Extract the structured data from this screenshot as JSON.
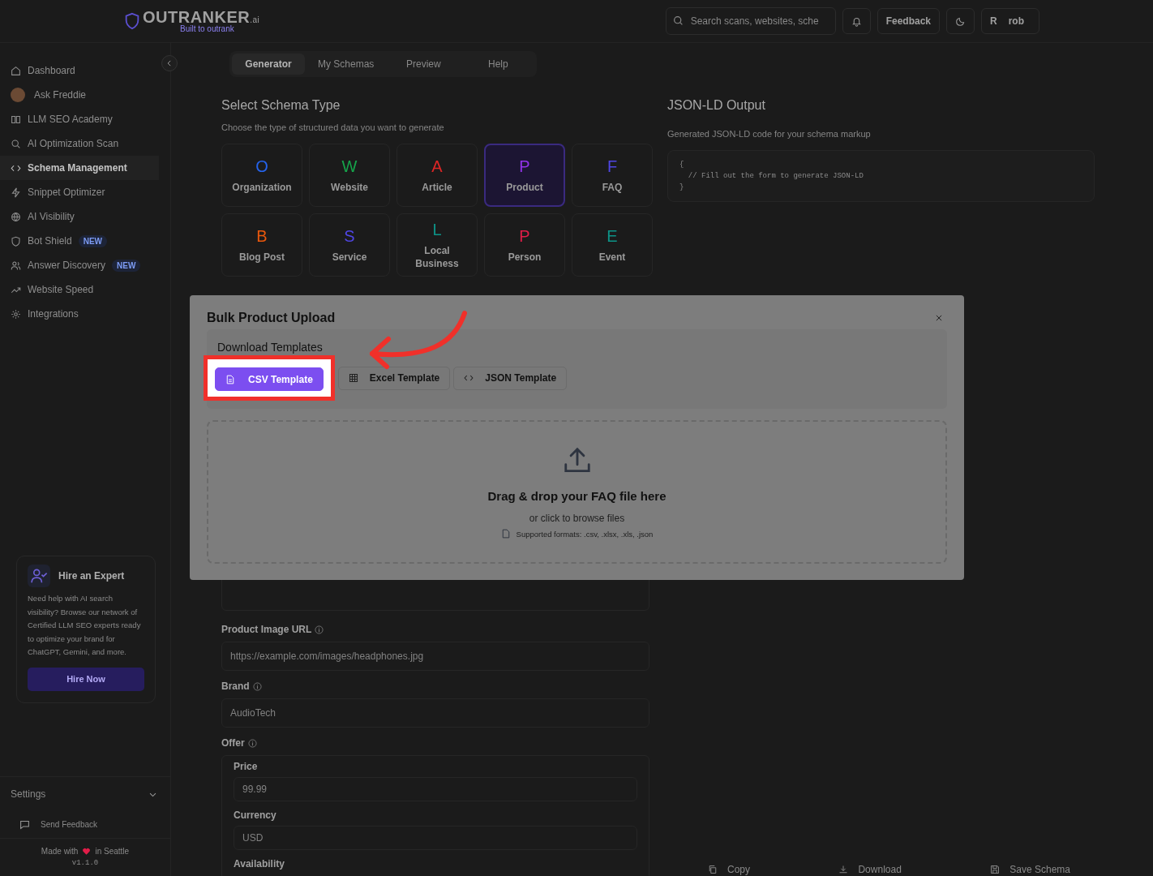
{
  "header": {
    "logo_text": "OUTRANKER",
    "logo_suffix": ".ai",
    "tagline": "Built to outrank",
    "search": {
      "placeholder": "Search scans, websites, sche"
    },
    "feedback": "Feedback",
    "user": {
      "initial": "R",
      "name": "rob"
    }
  },
  "sidebar": {
    "items": [
      {
        "label": "Dashboard",
        "selected": false
      },
      {
        "label": "Ask Freddie",
        "selected": false
      },
      {
        "label": "LLM SEO Academy",
        "selected": false
      },
      {
        "label": "AI Optimization Scan",
        "selected": false
      },
      {
        "label": "Schema Management",
        "selected": true
      },
      {
        "label": "Snippet Optimizer",
        "selected": false
      },
      {
        "label": "AI Visibility",
        "selected": false
      },
      {
        "label": "Bot Shield",
        "selected": false,
        "badge": "NEW"
      },
      {
        "label": "Answer Discovery",
        "selected": false,
        "badge": "NEW"
      },
      {
        "label": "Website Speed",
        "selected": false
      },
      {
        "label": "Integrations",
        "selected": false
      }
    ],
    "promo": {
      "title": "Hire an Expert",
      "text": "Need help with AI search visibility? Browse our network of Certified LLM SEO experts ready to optimize your brand for ChatGPT, Gemini, and more.",
      "button": "Hire Now"
    },
    "settings": "Settings",
    "send_feedback": "Send Feedback",
    "made_with": "Made with",
    "made_in": "in Seattle",
    "version": "v1.1.0"
  },
  "tabs": [
    {
      "label": "Generator",
      "selected": true
    },
    {
      "label": "My Schemas",
      "selected": false
    },
    {
      "label": "Preview",
      "selected": false
    },
    {
      "label": "Help",
      "selected": false
    }
  ],
  "schema_section": {
    "title": "Select Schema Type",
    "subtitle": "Choose the type of structured data you want to generate",
    "types": [
      {
        "letter": "O",
        "label": "Organization",
        "color": "#2563eb",
        "selected": false
      },
      {
        "letter": "W",
        "label": "Website",
        "color": "#16a34a",
        "selected": false
      },
      {
        "letter": "A",
        "label": "Article",
        "color": "#dc2626",
        "selected": false
      },
      {
        "letter": "P",
        "label": "Product",
        "color": "#9333ea",
        "selected": true
      },
      {
        "letter": "F",
        "label": "FAQ",
        "color": "#4f46e5",
        "selected": false
      },
      {
        "letter": "B",
        "label": "Blog Post",
        "color": "#ea580c",
        "selected": false
      },
      {
        "letter": "S",
        "label": "Service",
        "color": "#4f46e5",
        "selected": false
      },
      {
        "letter": "L",
        "label": "Local Business",
        "color": "#0d9488",
        "selected": false
      },
      {
        "letter": "P",
        "label": "Person",
        "color": "#e11d48",
        "selected": false
      },
      {
        "letter": "E",
        "label": "Event",
        "color": "#0d9488",
        "selected": false
      }
    ]
  },
  "form": {
    "fields": [
      {
        "label": "Product Image URL",
        "placeholder": "https://example.com/images/headphones.jpg"
      },
      {
        "label": "Brand",
        "placeholder": "AudioTech"
      }
    ],
    "offer": {
      "label": "Offer",
      "fields": [
        {
          "label": "Price",
          "placeholder": "99.99"
        },
        {
          "label": "Currency",
          "placeholder": "USD"
        }
      ],
      "last_label": "Availability"
    }
  },
  "output": {
    "title": "JSON-LD Output",
    "subtitle": "Generated JSON-LD code for your schema markup",
    "code": [
      "{",
      "  // Fill out the form to generate JSON-LD",
      "}"
    ],
    "actions": [
      "Copy",
      "Download",
      "Save Schema"
    ]
  },
  "modal": {
    "title": "Bulk Product Upload",
    "section": "Download Templates",
    "templates": [
      {
        "label": "CSV Template",
        "selected": true
      },
      {
        "label": "Excel Template",
        "selected": false
      },
      {
        "label": "JSON Template",
        "selected": false
      }
    ],
    "dropzone": {
      "title": "Drag & drop your FAQ file here",
      "subtitle": "or click to browse files",
      "formats": "Supported formats: .csv, .xlsx, .xls, .json"
    }
  }
}
